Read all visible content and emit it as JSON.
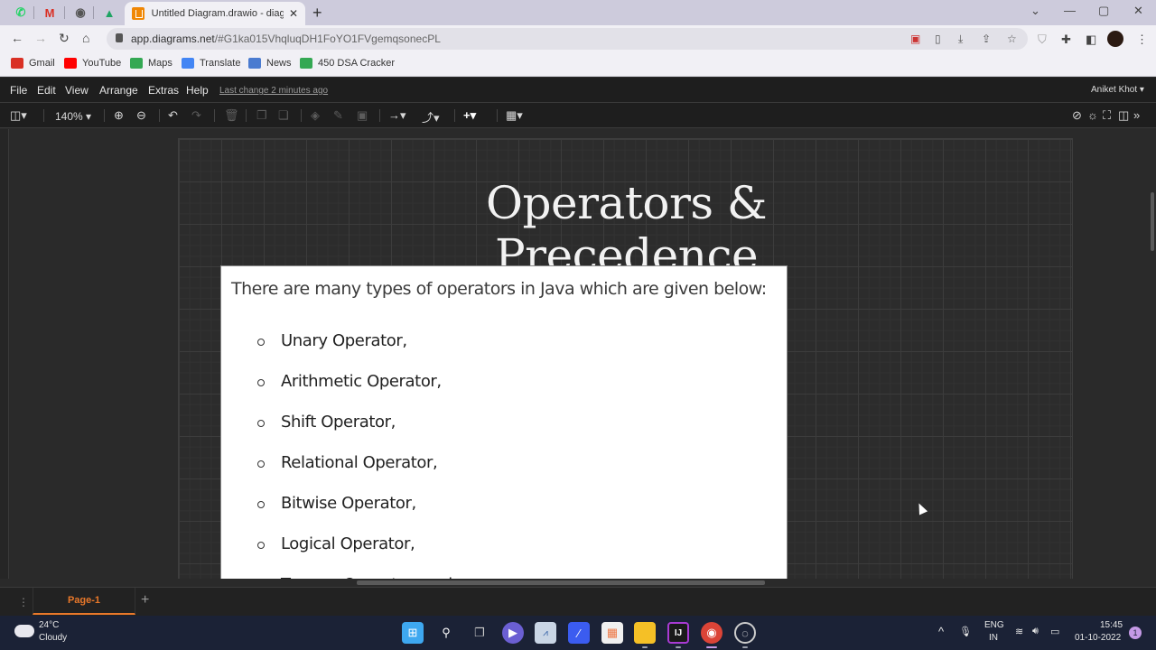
{
  "browser": {
    "pinned_tabs": [
      {
        "name": "whatsapp",
        "glyph": "✆",
        "color": "#25d366"
      },
      {
        "name": "gmail",
        "glyph": "M",
        "color": "#d93025"
      },
      {
        "name": "github",
        "glyph": "◉",
        "color": "#444444"
      },
      {
        "name": "google-drive",
        "glyph": "▲",
        "color": "#1fa463"
      }
    ],
    "active_tab": {
      "title": "Untitled Diagram.drawio - diagrams.net",
      "close": "✕"
    },
    "new_tab": "+",
    "window_controls": {
      "tab_search": "⌄",
      "minimize": "—",
      "maximize": "▢",
      "close": "✕"
    },
    "url_host": "app.diagrams.net",
    "url_rest": "/#G1ka015VhqluqDH1FoYO1FVgemqsonecPL",
    "bookmarks": [
      {
        "label": "Gmail",
        "color": "#d93025"
      },
      {
        "label": "YouTube",
        "color": "#ff0000"
      },
      {
        "label": "Maps",
        "color": "#34a853"
      },
      {
        "label": "Translate",
        "color": "#4285f4"
      },
      {
        "label": "News",
        "color": "#4a7bd0"
      },
      {
        "label": "450 DSA Cracker",
        "color": "#34a853"
      }
    ]
  },
  "drawio": {
    "menu": [
      "File",
      "Edit",
      "View",
      "Arrange",
      "Extras",
      "Help"
    ],
    "last_change": "Last change 2 minutes ago",
    "user": "Aniket Khot ▾",
    "zoom": "140% ▾",
    "diagram": {
      "title": "Operators & Precedence",
      "intro": "There are many types of operators in Java which are given below:",
      "operators": [
        "Unary Operator,",
        "Arithmetic Operator,",
        "Shift Operator,",
        "Relational Operator,",
        "Bitwise Operator,",
        "Logical Operator,",
        "Ternary Operator, and"
      ]
    },
    "page_tab": "Page-1",
    "add_page": "+"
  },
  "taskbar": {
    "temperature": "24°C",
    "weather": "Cloudy",
    "language": "ENG",
    "region": "IN",
    "time": "15:45",
    "date": "01-10-2022",
    "notifications": "1"
  }
}
